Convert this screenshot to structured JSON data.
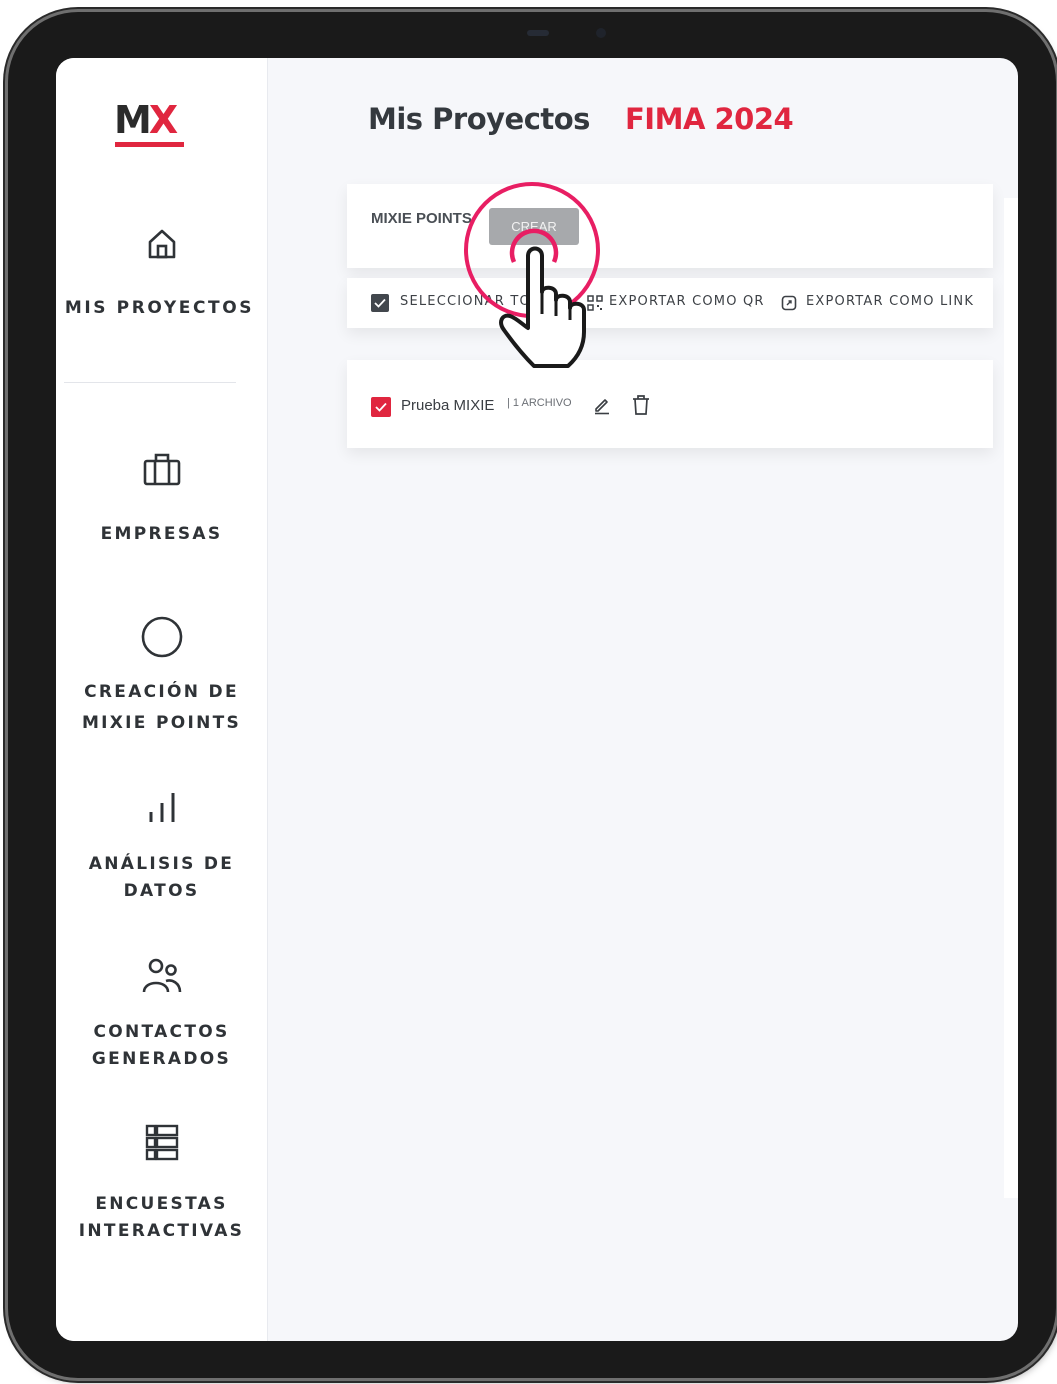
{
  "app": {
    "logo_text_main": "M",
    "logo_text_accent": "X"
  },
  "sidebar": {
    "items": [
      {
        "label": "MIS PROYECTOS",
        "icon": "home-icon"
      },
      {
        "label": "EMPRESAS",
        "icon": "briefcase-icon"
      },
      {
        "label_line1": "CREACIÓN DE",
        "label_line2": "MIXIE POINTS",
        "icon": "circle-icon"
      },
      {
        "label_line1": "ANÁLISIS DE",
        "label_line2": "DATOS",
        "icon": "bar-chart-icon"
      },
      {
        "label_line1": "CONTACTOS",
        "label_line2": "GENERADOS",
        "icon": "users-icon"
      },
      {
        "label_line1": "ENCUESTAS",
        "label_line2": "INTERACTIVAS",
        "icon": "list-icon"
      }
    ]
  },
  "header": {
    "title": "Mis Proyectos",
    "project": "FIMA 2024"
  },
  "points_card": {
    "label": "MIXIE POINTS",
    "create_label": "CREAR"
  },
  "actions_bar": {
    "select_all": "SELECCIONAR TO",
    "export_qr": "EXPORTAR COMO QR",
    "export_link": "EXPORTAR COMO LINK"
  },
  "rows": [
    {
      "name": "Prueba MIXIE",
      "count": "| 1 ARCHIVO"
    }
  ],
  "colors": {
    "accent": "#e0263f",
    "highlight": "#e81e63",
    "button_disabled": "#a7a9ac"
  }
}
